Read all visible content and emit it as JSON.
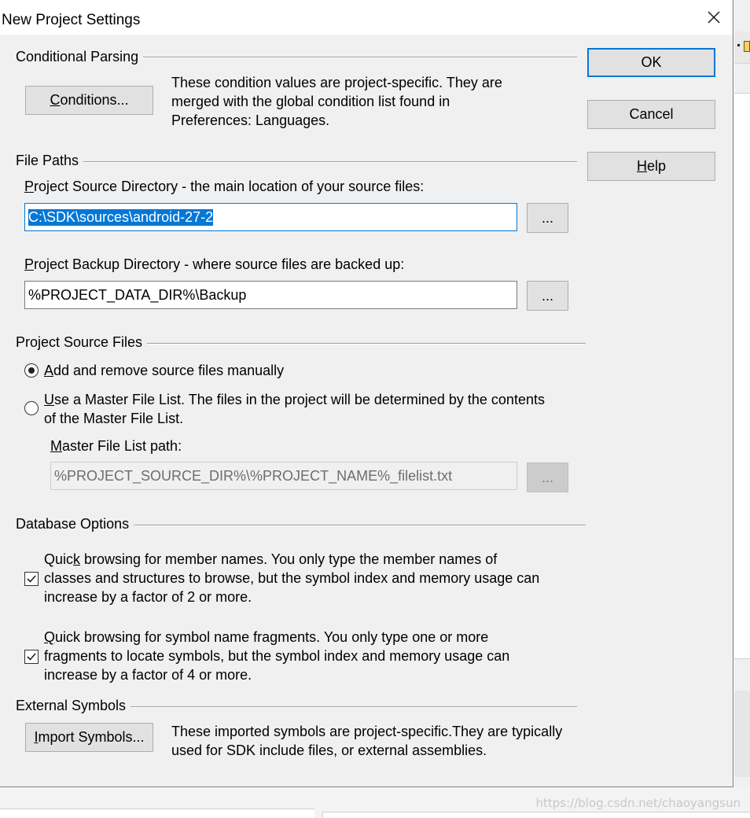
{
  "dialog": {
    "title": "New Project Settings"
  },
  "buttons": {
    "ok": "OK",
    "cancel": "Cancel",
    "help_first": "H",
    "help_rest": "elp",
    "conditions_first": "C",
    "conditions_rest": "onditions...",
    "import_first": "I",
    "import_rest": "mport Symbols...",
    "browse": "..."
  },
  "conditional_parsing": {
    "title": "Conditional Parsing",
    "desc_lines": [
      "These condition values are project-specific.  They are",
      "merged with the global condition list found in",
      "Preferences: Languages."
    ]
  },
  "file_paths": {
    "title": "File Paths",
    "source_label_first": "P",
    "source_label_rest": "roject Source Directory - the main location of your source files:",
    "source_value": "C:\\SDK\\sources\\android-27-2",
    "backup_label_first": "P",
    "backup_label_rest": "roject Backup Directory - where source files are backed up:",
    "backup_value": "%PROJECT_DATA_DIR%\\Backup"
  },
  "project_source_files": {
    "title": "Project Source Files",
    "option_manual_first": "A",
    "option_manual_rest": "dd and remove source files manually",
    "option_master_first": "U",
    "option_master_rest": "se a Master File List. The files in the project will be determined by the contents",
    "option_master_line2": "of the Master File List.",
    "selected_option": "manual",
    "master_label_first": "M",
    "master_label_rest": "aster File List path:",
    "master_value": "%PROJECT_SOURCE_DIR%\\%PROJECT_NAME%_filelist.txt"
  },
  "database_options": {
    "title": "Database Options",
    "opt1_pre": "Quic",
    "opt1_ul": "k",
    "opt1_rest": " browsing for member names.  You only type the member names of",
    "opt1_line2": "classes and structures to browse, but the symbol index and memory usage can",
    "opt1_line3": "increase by a factor of 2 or more.",
    "opt1_checked": true,
    "opt2_first": "Q",
    "opt2_rest": "uick browsing for symbol name fragments.  You only type one or more",
    "opt2_line2": "fragments to locate symbols, but the symbol index and memory usage can",
    "opt2_line3": "increase by a factor of 4 or more.",
    "opt2_checked": true
  },
  "external_symbols": {
    "title": "External Symbols",
    "desc_lines": [
      "These imported symbols are project-specific.They are typically",
      "used for SDK include files, or external assemblies."
    ]
  },
  "watermark": "https://blog.csdn.net/chaoyangsun",
  "colors": {
    "accent": "#0078d7",
    "dialog_bg": "#f0f0f0",
    "button_bg": "#e1e1e1"
  }
}
